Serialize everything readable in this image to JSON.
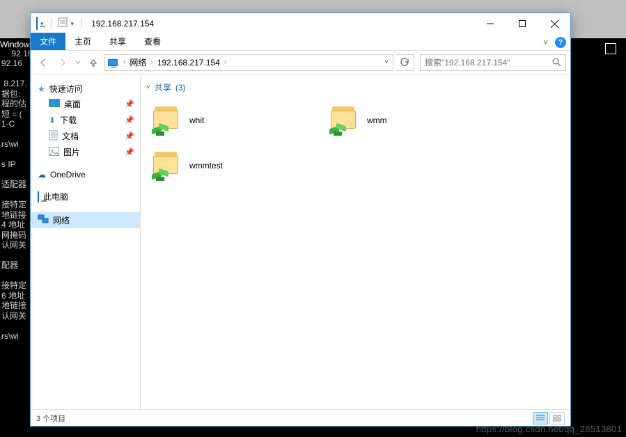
{
  "terminal": {
    "title_fragment": "Window",
    "lines": "92.16\n92.16\n\n 8.217.\n据包:\n程的估\n短 = (\n1-C\n\nrs\\wi\n\ns IP \n\n适配器\n\n接特定\n地链接\n4 地址\n网掩码\n认网关\n\n配器\n\n接特定\n6 地址\n地链接\n认网关\n\nrs\\wi"
  },
  "titlebar": {
    "address": "192.168.217.154"
  },
  "ribbon": {
    "file": "文件",
    "tabs": [
      "主页",
      "共享",
      "查看"
    ],
    "expand_hint": "˅"
  },
  "nav": {
    "crumbs": [
      "网络",
      "192.168.217.154"
    ],
    "search_placeholder": "搜索\"192.168.217.154\""
  },
  "sidebar": {
    "quick": "快速访问",
    "quick_items": [
      {
        "label": "桌面",
        "icon": "desktop",
        "pinned": true
      },
      {
        "label": "下载",
        "icon": "download",
        "pinned": true
      },
      {
        "label": "文档",
        "icon": "doc",
        "pinned": true
      },
      {
        "label": "图片",
        "icon": "pic",
        "pinned": true
      }
    ],
    "onedrive": "OneDrive",
    "thispc": "此电脑",
    "network": "网络"
  },
  "content": {
    "group_label": "共享",
    "group_count": 3,
    "items": [
      {
        "name": "whit"
      },
      {
        "name": "wmm"
      },
      {
        "name": "wmmtest"
      }
    ]
  },
  "status": {
    "text": "3 个项目"
  },
  "watermark": "https://blog.csdn.net/qq_28513801",
  "background_window": {
    "maximize_visible": true
  }
}
